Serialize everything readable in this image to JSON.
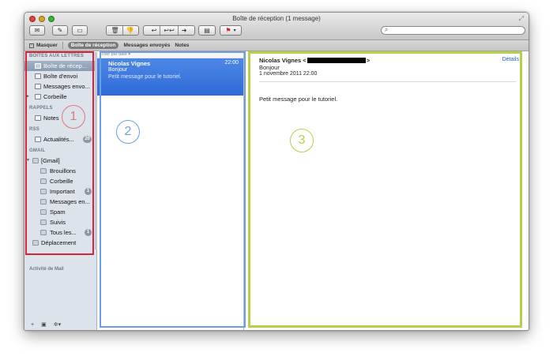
{
  "window": {
    "title": "Boîte de réception (1 message)"
  },
  "toolbar": {
    "buttons": [
      {
        "name": "get-mail",
        "glyph": "✉"
      },
      {
        "name": "compose",
        "glyph": "✎"
      },
      {
        "name": "note",
        "glyph": "▭"
      },
      {
        "name": "delete",
        "glyph": "🗑"
      },
      {
        "name": "junk",
        "glyph": "👎"
      },
      {
        "name": "reply",
        "glyph": "↩"
      },
      {
        "name": "reply-all",
        "glyph": "↩↩"
      },
      {
        "name": "forward",
        "glyph": "➜"
      },
      {
        "name": "print",
        "glyph": "▤"
      },
      {
        "name": "flag",
        "glyph": "⚑"
      },
      {
        "name": "flag-menu",
        "glyph": "▾"
      }
    ],
    "search_placeholder": ""
  },
  "favorites": {
    "hide_label": "Masquer",
    "items": [
      "Boîte de réception",
      "Messages envoyés",
      "Notes"
    ],
    "active_index": 0
  },
  "sidebar": {
    "sections": [
      {
        "header": "BOÎTES AUX LETTRES",
        "items": [
          {
            "label": "Boîte de récep...",
            "selected": true
          },
          {
            "label": "Boîte d'envoi"
          },
          {
            "label": "Messages envo..."
          },
          {
            "label": "Corbeille",
            "disclosure": "▶"
          }
        ]
      },
      {
        "header": "RAPPELS",
        "items": [
          {
            "label": "Notes"
          }
        ]
      },
      {
        "header": "RSS",
        "items": [
          {
            "label": "Actualités...",
            "badge": "20"
          }
        ]
      },
      {
        "header": "GMAIL",
        "items": [
          {
            "label": "[Gmail]",
            "disclosure": "▼",
            "folder": true
          },
          {
            "label": "Brouillons",
            "folder": true,
            "indent": 1
          },
          {
            "label": "Corbeille",
            "folder": true,
            "indent": 1
          },
          {
            "label": "Important",
            "folder": true,
            "indent": 1,
            "badge": "1"
          },
          {
            "label": "Messages en...",
            "folder": true,
            "indent": 1
          },
          {
            "label": "Spam",
            "folder": true,
            "indent": 1
          },
          {
            "label": "Suivis",
            "folder": true,
            "indent": 1
          },
          {
            "label": "Tous les...",
            "folder": true,
            "indent": 1,
            "badge": "1"
          },
          {
            "label": "Déplacement",
            "folder": true
          }
        ]
      }
    ],
    "activity_label": "Activité de Mail",
    "footer": [
      "+",
      "▣",
      "✲▾"
    ]
  },
  "message_list": {
    "sort_label": "Trier par date ▾",
    "messages": [
      {
        "from": "Nicolas Vignes",
        "time": "22:00",
        "subject": "Bonjour",
        "preview": "Petit message pour le tutoriel."
      }
    ]
  },
  "reader": {
    "from_name": "Nicolas Vignes <",
    "from_end": ">",
    "details_label": "Détails",
    "subject": "Bonjour",
    "date": "1 novembre 2011 22:00",
    "body": "Petit message pour le tutoriel."
  },
  "annotations": {
    "labels": [
      "1",
      "2",
      "3"
    ],
    "colors": {
      "red": "#d8233a",
      "blue": "#6c9ee6",
      "green": "#b6d04a"
    }
  }
}
